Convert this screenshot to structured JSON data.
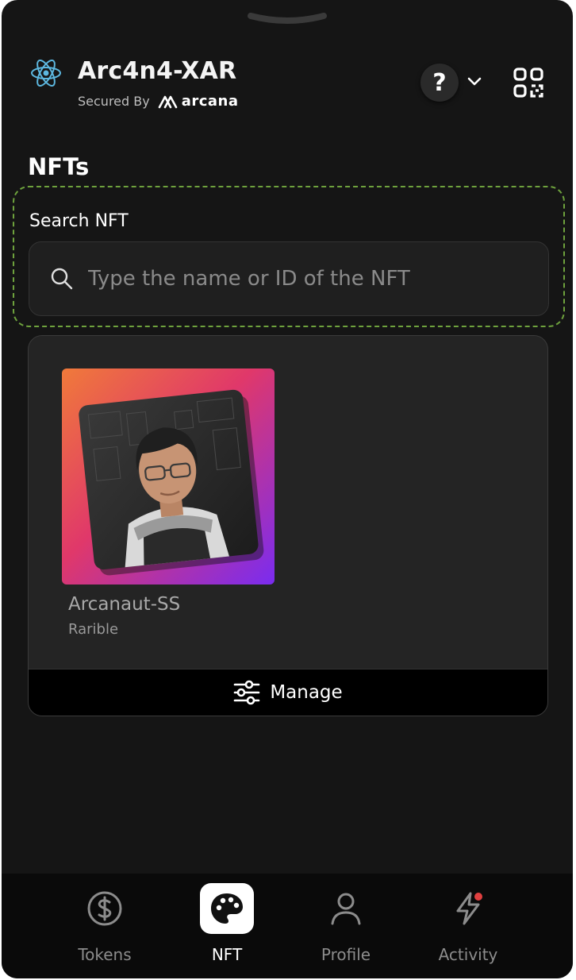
{
  "header": {
    "app_title": "Arc4n4-XAR",
    "secured_by": "Secured By",
    "brand": "arcana",
    "help_symbol": "?",
    "icons": {
      "logo": "react-atom-icon",
      "help": "question-icon",
      "chevron": "chevron-down-icon",
      "qr": "qr-scan-icon"
    }
  },
  "page": {
    "title": "NFTs"
  },
  "search": {
    "label": "Search NFT",
    "placeholder": "Type the name or ID of the NFT",
    "value": ""
  },
  "nfts": [
    {
      "name": "Arcanaut-SS",
      "collection": "Rarible"
    }
  ],
  "manage": {
    "label": "Manage",
    "icon": "sliders-icon"
  },
  "bottom_nav": [
    {
      "label": "Tokens",
      "icon": "dollar-circle-icon",
      "active": false
    },
    {
      "label": "NFT",
      "icon": "palette-icon",
      "active": true
    },
    {
      "label": "Profile",
      "icon": "user-icon",
      "active": false
    },
    {
      "label": "Activity",
      "icon": "lightning-icon",
      "active": false,
      "notification_dot": true
    }
  ],
  "colors": {
    "background": "#151515",
    "accent_dashed": "#6ea23d",
    "notification": "#e04040"
  }
}
